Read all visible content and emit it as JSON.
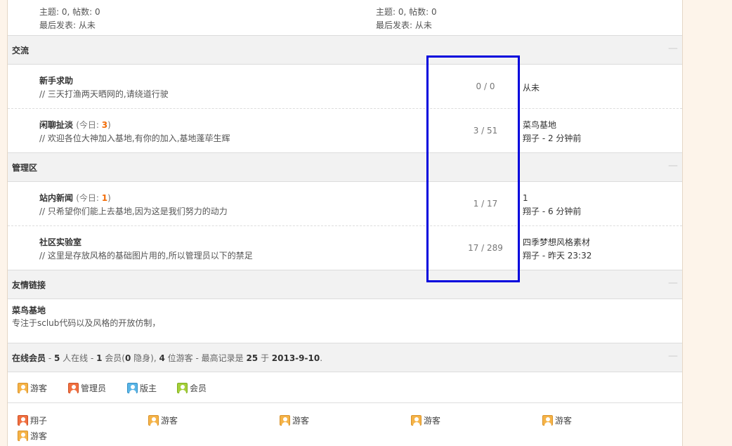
{
  "top_forums": [
    {
      "stats": "主题: 0, 帖数: 0",
      "last": "最后发表: 从未"
    },
    {
      "stats": "主题: 0, 帖数: 0",
      "last": "最后发表: 从未"
    }
  ],
  "categories": {
    "exchange": "交流",
    "admin": "管理区",
    "links": "友情链接"
  },
  "forums": {
    "help": {
      "name": "新手求助",
      "desc": "// 三天打渔两天晒网的,请绕道行驶",
      "stats": "0 / 0",
      "last1": "从未",
      "last2": ""
    },
    "chat": {
      "name": "闲聊扯淡",
      "today_label": "(今日: ",
      "today": "3",
      "today_end": ")",
      "desc": "// 欢迎各位大神加入基地,有你的加入,基地蓬荜生辉",
      "stats": "3 / 51",
      "last1": "菜鸟基地",
      "last2": "翔子 - 2 分钟前"
    },
    "news": {
      "name": "站内新闻",
      "today_label": "(今日: ",
      "today": "1",
      "today_end": ")",
      "desc": "// 只希望你们能上去基地,因为这是我们努力的动力",
      "stats": "1 / 17",
      "last1": "1",
      "last2": "翔子 - 6 分钟前"
    },
    "lab": {
      "name": "社区实验室",
      "desc": "// 这里是存放风格的基础图片用的,所以管理员以下的禁足",
      "stats": "17 / 289",
      "last1": "四季梦想风格素材",
      "last2": "翔子 - 昨天 23:32"
    }
  },
  "friend_link": {
    "name": "菜鸟基地",
    "desc": "专注于sclub代码以及风格的开放仿制，"
  },
  "online": {
    "title": "在线会员",
    "dash1": " - ",
    "count": "5",
    "t1": " 人在线 - ",
    "members": "1",
    "t2": " 会员(",
    "hidden": "0",
    "t3": " 隐身), ",
    "guests": "4",
    "t4": " 位游客 - 最高记录是 ",
    "record": "25",
    "t5": " 于 ",
    "record_date": "2013-9-10",
    "t6": "."
  },
  "legend": [
    "游客",
    "管理员",
    "版主",
    "会员"
  ],
  "users": [
    "翔子",
    "游客",
    "游客",
    "游客",
    "游客",
    "游客"
  ],
  "collapse_glyph": "—"
}
